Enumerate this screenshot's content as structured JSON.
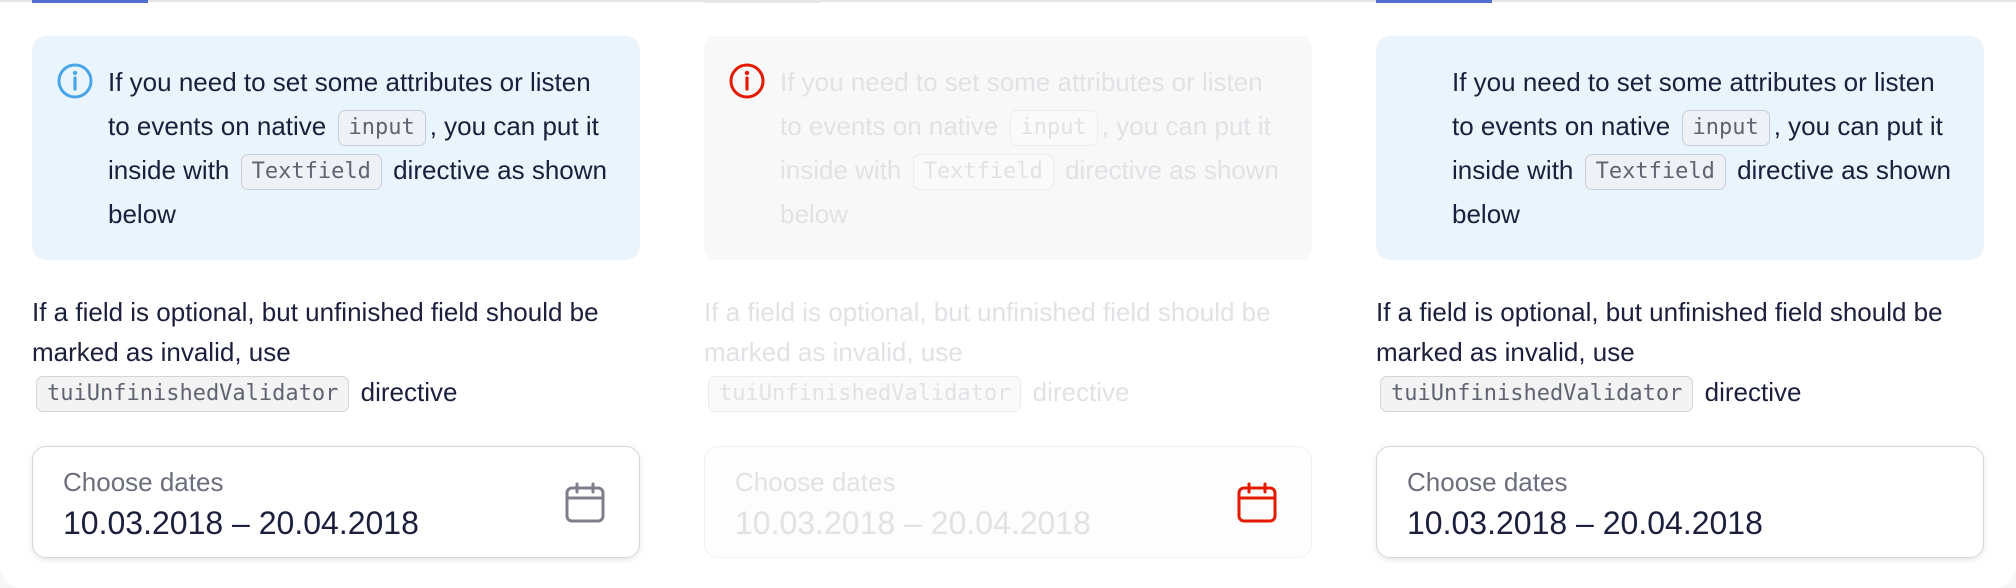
{
  "panels": [
    {
      "state": "normal",
      "notification": {
        "icon": "info-icon",
        "icon_color": "#4aa5e8",
        "text_before": "If you need to set some attributes or listen to events on native",
        "code1": "input",
        "text_middle": ", you can put it inside with",
        "code2": "Textfield",
        "text_after": "directive as shown below"
      },
      "description": {
        "text": "If a field is optional, but unfinished field should be marked as invalid, use",
        "code": "tuiUnfinishedValidator",
        "suffix": "directive"
      },
      "field": {
        "label": "Choose dates",
        "value": "10.03.2018 – 20.04.2018",
        "icon": "calendar-icon",
        "icon_color": "#7d808a"
      }
    },
    {
      "state": "disabled",
      "notification": {
        "icon": "info-icon",
        "icon_color": "#e31a00",
        "text_before": "If you need to set some attributes or listen to events on native",
        "code1": "input",
        "text_middle": ", you can put it inside with",
        "code2": "Textfield",
        "text_after": "directive as shown below"
      },
      "description": {
        "text": "If a field is optional, but unfinished field should be marked as invalid, use",
        "code": "tuiUnfinishedValidator",
        "suffix": "directive"
      },
      "field": {
        "label": "Choose dates",
        "value": "10.03.2018 – 20.04.2018",
        "icon": "calendar-icon",
        "icon_color": "#e31a00"
      }
    },
    {
      "state": "normal-no-icon",
      "notification": {
        "text_before": "If you need to set some attributes or listen to events on native",
        "code1": "input",
        "text_middle": ", you can put it inside with",
        "code2": "Textfield",
        "text_after": "directive as shown below"
      },
      "description": {
        "text": "If a field is optional, but unfinished field should be marked as invalid, use",
        "code": "tuiUnfinishedValidator",
        "suffix": "directive"
      },
      "field": {
        "label": "Choose dates",
        "value": "10.03.2018 – 20.04.2018"
      }
    }
  ]
}
